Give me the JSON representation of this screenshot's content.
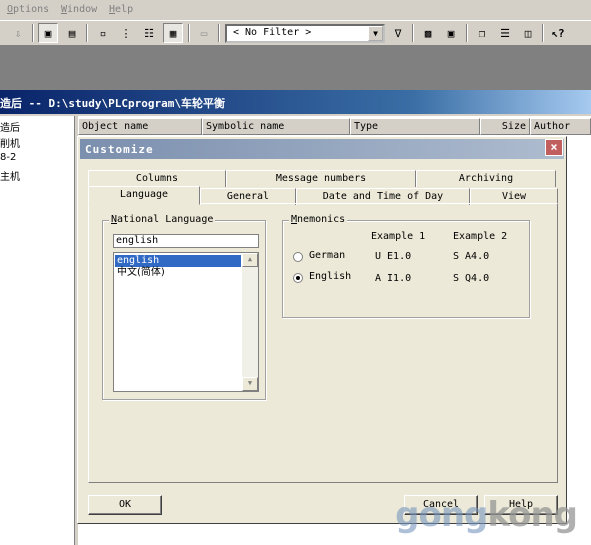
{
  "menubar": {
    "items": [
      {
        "underline": "O",
        "rest": "ptions"
      },
      {
        "underline": "W",
        "rest": "indow"
      },
      {
        "underline": "H",
        "rest": "elp"
      }
    ]
  },
  "toolbar": {
    "filter_value": "< No Filter >",
    "icons": [
      "download-icon",
      "network-icon",
      "network-config-icon",
      "small-icons-icon",
      "list-icon",
      "details-icon",
      "table-icon",
      "disabled-icon",
      "filter-icon",
      "layout-icon",
      "memory-icon",
      "cascade-icon",
      "tile-horizontal-icon",
      "tile-vertical-icon",
      "help-pointer-icon"
    ]
  },
  "project_window": {
    "title": "造后 -- D:\\study\\PLCprogram\\车轮平衡",
    "tree_items": [
      "造后",
      "削机",
      "8-2",
      "主机"
    ],
    "columns": [
      "Object name",
      "Symbolic name",
      "Type",
      "Size",
      "Author"
    ]
  },
  "dialog": {
    "title": "Customize",
    "close_glyph": "×",
    "tabs_row1": [
      "Columns",
      "Message numbers",
      "Archiving"
    ],
    "tabs_row2": [
      "Language",
      "General",
      "Date and Time of Day",
      "View"
    ],
    "active_tab": "Language",
    "national_language": {
      "label_underline": "N",
      "label_rest": "ational Language",
      "current": "english",
      "options": [
        "english",
        "中文(简体)"
      ],
      "selected": "english"
    },
    "mnemonics": {
      "label_underline": "M",
      "label_rest": "nemonics",
      "header_example1": "Example 1",
      "header_example2": "Example 2",
      "rows": [
        {
          "label": "German",
          "ex1": "U E1.0",
          "ex2": "S A4.0",
          "selected": false
        },
        {
          "label": "English",
          "ex1": "A I1.0",
          "ex2": "S Q4.0",
          "selected": true
        }
      ]
    },
    "buttons": {
      "ok": "OK",
      "cancel": "Cancel",
      "help": "Help"
    }
  },
  "watermark": {
    "part1": "gong",
    "part2": "kong"
  }
}
